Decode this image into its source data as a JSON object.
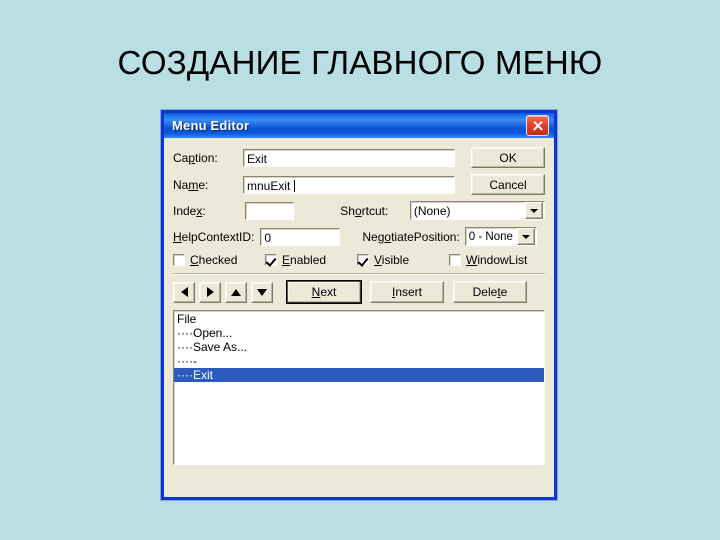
{
  "slide": {
    "title": "СОЗДАНИЕ ГЛАВНОГО МЕНЮ",
    "background_color": "#b9dfe4"
  },
  "dialog": {
    "title": "Menu Editor",
    "close_icon": "close-icon",
    "titlebar_color": "#0a51d2",
    "face_color": "#ece9d8",
    "fields": {
      "caption_label": "Caption:",
      "caption_value": "Exit",
      "name_label": "Name:",
      "name_value": "mnuExit",
      "index_label": "Index:",
      "index_value": "",
      "shortcut_label": "Shortcut:",
      "shortcut_value": "(None)",
      "helpcontextid_label": "HelpContextID:",
      "helpcontextid_value": "0",
      "negotiateposition_label": "NegotiatePosition:",
      "negotiateposition_value": "0 - None"
    },
    "checkboxes": [
      {
        "label": "Checked",
        "checked": false
      },
      {
        "label": "Enabled",
        "checked": true
      },
      {
        "label": "Visible",
        "checked": true
      },
      {
        "label": "WindowList",
        "checked": false
      }
    ],
    "side_buttons": {
      "ok": "OK",
      "cancel": "Cancel"
    },
    "nav_buttons": [
      {
        "name": "move-left-button",
        "icon": "arrow-left-icon"
      },
      {
        "name": "move-right-button",
        "icon": "arrow-right-icon"
      },
      {
        "name": "move-up-button",
        "icon": "arrow-up-icon"
      },
      {
        "name": "move-down-button",
        "icon": "arrow-down-icon"
      }
    ],
    "action_buttons": {
      "next": "Next",
      "insert": "Insert",
      "delete": "Delete"
    },
    "menu_list": {
      "selection_color": "#2a5bbd",
      "items": [
        {
          "text": "File",
          "selected": false
        },
        {
          "text": "····Open...",
          "selected": false
        },
        {
          "text": "····Save As...",
          "selected": false
        },
        {
          "text": "····-",
          "selected": false
        },
        {
          "text": "····Exit",
          "selected": true
        }
      ]
    }
  }
}
